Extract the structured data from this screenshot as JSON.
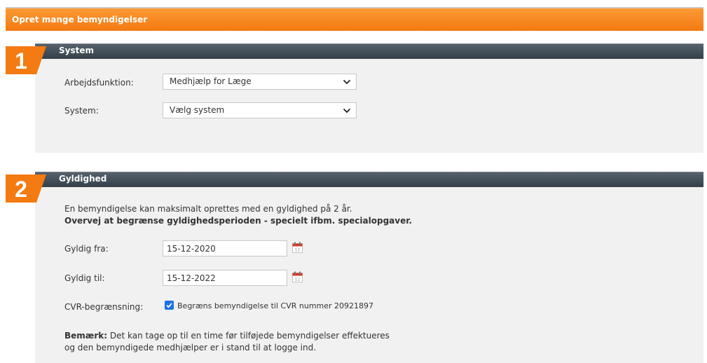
{
  "header": {
    "title": "Opret mange bemyndigelser"
  },
  "section1": {
    "number": "1",
    "title": "System",
    "fields": [
      {
        "label": "Arbejdsfunktion:",
        "value": "Medhjælp for Læge"
      },
      {
        "label": "System:",
        "value": "Vælg system"
      }
    ]
  },
  "section2": {
    "number": "2",
    "title": "Gyldighed",
    "intro_line1": "En bemyndigelse kan maksimalt oprettes med en gyldighed på 2 år.",
    "intro_line2": "Overvej at begrænse gyldighedsperioden - specielt ifbm. specialopgaver.",
    "valid_from_label": "Gyldig fra:",
    "valid_from_value": "15-12-2020",
    "valid_to_label": "Gyldig til:",
    "valid_to_value": "15-12-2022",
    "cvr_label": "CVR-begrænsning:",
    "cvr_checked": true,
    "cvr_checkbox_label": "Begræns bemyndigelse til CVR nummer 20921897",
    "note_bold": "Bemærk:",
    "note_text1": " Det kan tage op til en time før tilføjede bemyndigelser effektueres",
    "note_text2": "og den bemyndigede medhjælper er i stand til at logge ind."
  },
  "colors": {
    "accent": "#f47a12",
    "section_bar": "#3d4853",
    "body_bg": "#f1f1f1",
    "checkbox": "#1a73e8"
  },
  "icons": {
    "select_arrow": "chevron-down-icon",
    "date_picker": "calendar-icon",
    "checkbox": "checkmark-icon"
  }
}
